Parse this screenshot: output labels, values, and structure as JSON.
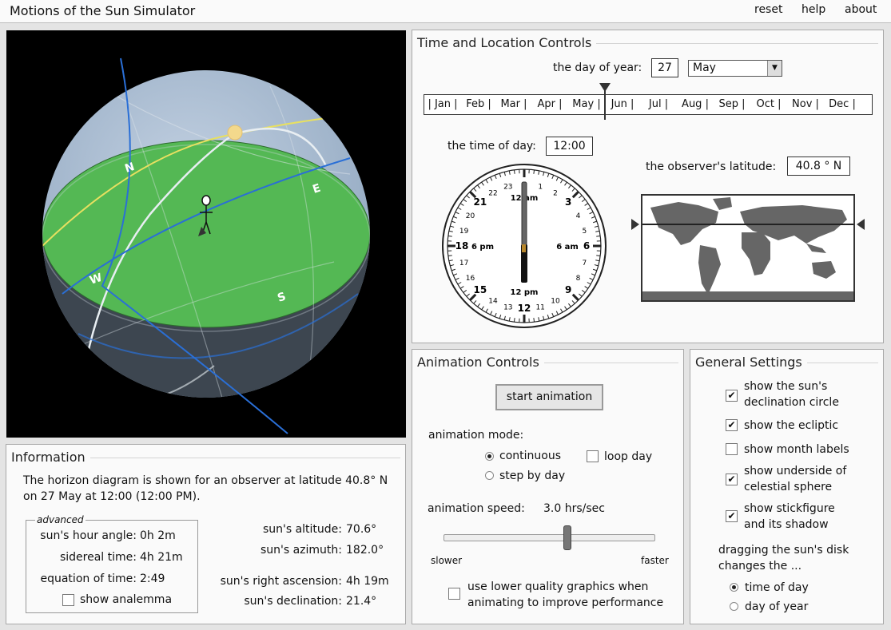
{
  "app": {
    "title": "Motions of the Sun Simulator"
  },
  "nav": {
    "reset": "reset",
    "help": "help",
    "about": "about"
  },
  "sphere": {
    "north": "N",
    "east": "E",
    "south": "S",
    "west": "W"
  },
  "time_location": {
    "title": "Time and Location Controls",
    "day_label": "the day of year:",
    "day_value": "27",
    "month_selected": "May",
    "months": [
      "Jan",
      "Feb",
      "Mar",
      "Apr",
      "May",
      "Jun",
      "Jul",
      "Aug",
      "Sep",
      "Oct",
      "Nov",
      "Dec"
    ],
    "time_label": "the time of day:",
    "time_value": "12:00",
    "latitude_label": "the observer's latitude:",
    "latitude_value": "40.8 ° N"
  },
  "clock": {
    "label_12am": "12 am",
    "label_6pm": "6 pm",
    "label_6am": "6 am",
    "label_12pm": "12 pm",
    "hours": [
      "0",
      "1",
      "2",
      "3",
      "4",
      "5",
      "6",
      "7",
      "8",
      "9",
      "10",
      "11",
      "12",
      "13",
      "14",
      "15",
      "16",
      "17",
      "18",
      "19",
      "20",
      "21",
      "22",
      "23"
    ]
  },
  "information": {
    "title": "Information",
    "line1": "The horizon diagram is shown for an observer at latitude 40.8° N",
    "line2": "on 27 May at 12:00 (12:00 PM).",
    "advanced_legend": "advanced",
    "hour_angle_label": "sun's hour angle:",
    "hour_angle_value": "0h 2m",
    "sidereal_label": "sidereal time:",
    "sidereal_value": "4h 21m",
    "eot_label": "equation of time:",
    "eot_value": "2:49",
    "analemma_label": "show analemma",
    "altitude_label": "sun's altitude:",
    "altitude_value": "70.6°",
    "azimuth_label": "sun's azimuth:",
    "azimuth_value": "182.0°",
    "ra_label": "sun's right ascension:",
    "ra_value": "4h 19m",
    "dec_label": "sun's declination:",
    "dec_value": "21.4°"
  },
  "animation": {
    "title": "Animation Controls",
    "start_button": "start animation",
    "mode_label": "animation mode:",
    "mode_continuous": "continuous",
    "mode_step": "step by day",
    "loop_day": "loop day",
    "speed_label": "animation speed:",
    "speed_value": "3.0 hrs/sec",
    "slower": "slower",
    "faster": "faster",
    "speed_fraction": 0.59,
    "low_quality_line1": "use lower quality graphics when",
    "low_quality_line2": "animating to improve performance"
  },
  "general": {
    "title": "General Settings",
    "decl_line1": "show the sun's",
    "decl_line2": "declination circle",
    "ecliptic": "show the ecliptic",
    "month_labels": "show month labels",
    "underside_line1": "show underside of",
    "underside_line2": "celestial sphere",
    "stick_line1": "show stickfigure",
    "stick_line2": "and its shadow",
    "drag_line1": "dragging the sun's disk",
    "drag_line2": "changes the ...",
    "drag_time": "time of day",
    "drag_year": "day of year"
  },
  "checks": {
    "on": "✔",
    "off": ""
  },
  "colors": {
    "ground": "#54b854",
    "sky": "#aabdd4",
    "accent_blue": "#2a6fd6",
    "ecliptic": "#e8e060",
    "sun": "#f3d98c"
  }
}
